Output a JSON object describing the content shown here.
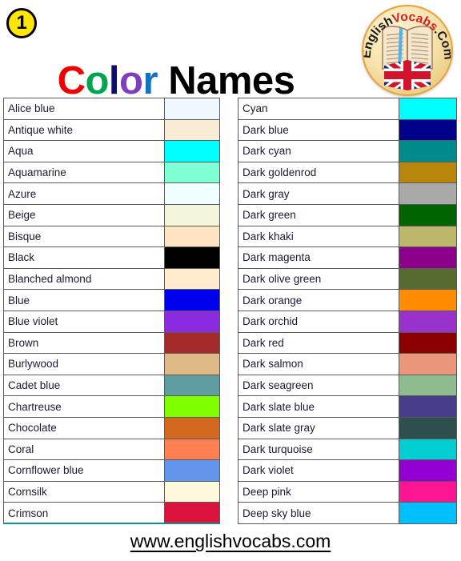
{
  "badge": {
    "number": "1"
  },
  "title": {
    "parts": [
      {
        "text": "C",
        "color": "#ee0000"
      },
      {
        "text": "o",
        "color": "#00a550"
      },
      {
        "text": "l",
        "color": "#0d0d6b"
      },
      {
        "text": "o",
        "color": "#7b3fbf"
      },
      {
        "text": "r",
        "color": "#1272c4"
      },
      {
        "text": " ",
        "color": "#000000"
      },
      {
        "text": "Names",
        "color": "#000000"
      }
    ],
    "plain": "Color Names"
  },
  "logo": {
    "word1": "English",
    "word2": "Vocabs",
    "word3": ".Com",
    "word1_color": "#1a1a1a",
    "word2_color": "#d32020",
    "word3_color": "#1a1a1a",
    "badge_bg": "#f3dfa8",
    "badge_border": "#e8a33d",
    "icon": "open-book-uk-flag"
  },
  "footer": {
    "url": "www.englishvocabs.com"
  },
  "left_table": {
    "rows": [
      {
        "name": "Alice blue",
        "hex": "#f0f8ff"
      },
      {
        "name": "Antique white",
        "hex": "#faebd7"
      },
      {
        "name": "Aqua",
        "hex": "#00ffff"
      },
      {
        "name": "Aquamarine",
        "hex": "#7fffd4"
      },
      {
        "name": "Azure",
        "hex": "#f0ffff"
      },
      {
        "name": "Beige",
        "hex": "#f5f5dc"
      },
      {
        "name": "Bisque",
        "hex": "#ffe4c4"
      },
      {
        "name": "Black",
        "hex": "#000000"
      },
      {
        "name": "Blanched almond",
        "hex": "#ffebcd"
      },
      {
        "name": "Blue",
        "hex": "#0000ee"
      },
      {
        "name": "Blue violet",
        "hex": "#8a2be2"
      },
      {
        "name": "Brown",
        "hex": "#a52a2a"
      },
      {
        "name": "Burlywood",
        "hex": "#deb887"
      },
      {
        "name": "Cadet blue",
        "hex": "#5f9ea0"
      },
      {
        "name": "Chartreuse",
        "hex": "#7fff00"
      },
      {
        "name": "Chocolate",
        "hex": "#d2691e"
      },
      {
        "name": "Coral",
        "hex": "#ff7f50"
      },
      {
        "name": "Cornflower blue",
        "hex": "#6495ed"
      },
      {
        "name": "Cornsilk",
        "hex": "#fff8dc"
      },
      {
        "name": "Crimson",
        "hex": "#dc143c"
      }
    ]
  },
  "right_table": {
    "rows": [
      {
        "name": "Cyan",
        "hex": "#00ffff"
      },
      {
        "name": "Dark blue",
        "hex": "#00008b"
      },
      {
        "name": "Dark cyan",
        "hex": "#008b8b"
      },
      {
        "name": "Dark goldenrod",
        "hex": "#b8860b"
      },
      {
        "name": "Dark gray",
        "hex": "#a9a9a9"
      },
      {
        "name": "Dark green",
        "hex": "#006400"
      },
      {
        "name": "Dark khaki",
        "hex": "#bdb76b"
      },
      {
        "name": "Dark magenta",
        "hex": "#8b008b"
      },
      {
        "name": "Dark olive green",
        "hex": "#556b2f"
      },
      {
        "name": "Dark orange",
        "hex": "#ff8c00"
      },
      {
        "name": "Dark orchid",
        "hex": "#9932cc"
      },
      {
        "name": "Dark red",
        "hex": "#8b0000"
      },
      {
        "name": "Dark salmon",
        "hex": "#e9967a"
      },
      {
        "name": "Dark seagreen",
        "hex": "#8fbc8f"
      },
      {
        "name": "Dark slate blue",
        "hex": "#483d8b"
      },
      {
        "name": "Dark slate gray",
        "hex": "#2f4f4f"
      },
      {
        "name": "Dark turquoise",
        "hex": "#00ced1"
      },
      {
        "name": "Dark violet",
        "hex": "#9400d3"
      },
      {
        "name": "Deep pink",
        "hex": "#ff1493"
      },
      {
        "name": "Deep sky blue",
        "hex": "#00bfff"
      }
    ]
  }
}
